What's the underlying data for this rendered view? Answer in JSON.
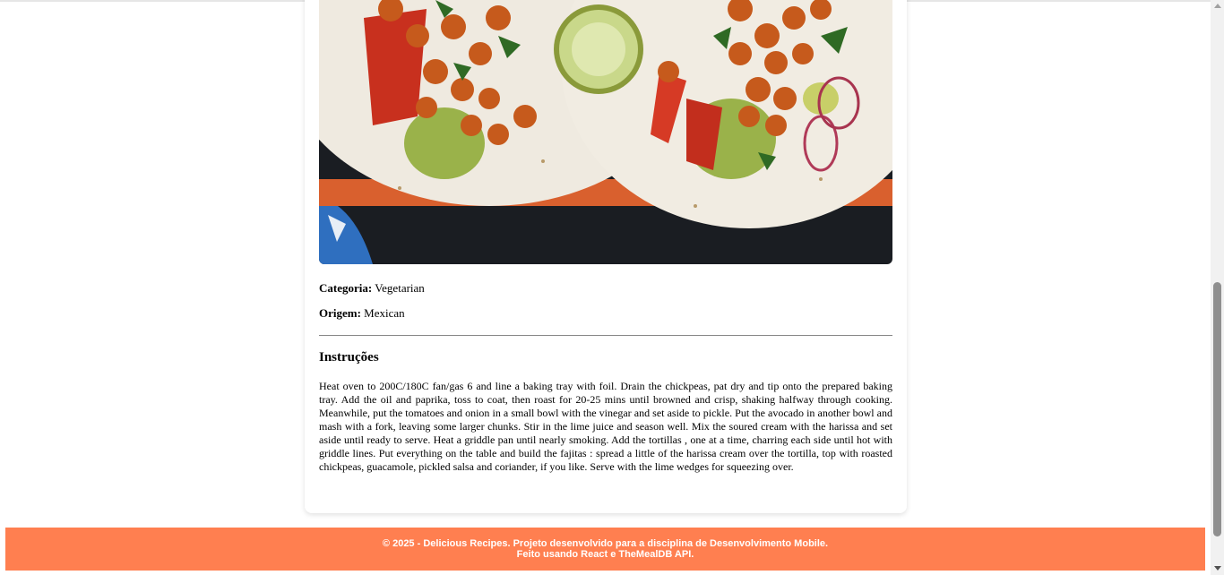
{
  "recipe": {
    "category_label": "Categoria:",
    "category": "Vegetarian",
    "origin_label": "Origem:",
    "origin": "Mexican",
    "instructions_title": "Instruções",
    "instructions": "Heat oven to 200C/180C fan/gas 6 and line a baking tray with foil. Drain the chickpeas, pat dry and tip onto the prepared baking tray. Add the oil and paprika, toss to coat, then roast for 20-25 mins until browned and crisp, shaking halfway through cooking. Meanwhile, put the tomatoes and onion in a small bowl with the vinegar and set aside to pickle. Put the avocado in another bowl and mash with a fork, leaving some larger chunks. Stir in the lime juice and season well. Mix the soured cream with the harissa and set aside until ready to serve. Heat a griddle pan until nearly smoking. Add the tortillas , one at a time, charring each side until hot with griddle lines. Put everything on the table and build the fajitas : spread a little of the harissa cream over the tortilla, top with roasted chickpeas, guacamole, pickled salsa and coriander, if you like. Serve with the lime wedges for squeezing over."
  },
  "footer": {
    "line1": "© 2025 - Delicious Recipes. Projeto desenvolvido para a disciplina de Desenvolvimento Mobile.",
    "line2": "Feito usando React e TheMealDB API."
  },
  "colors": {
    "footer_bg": "#ff7f50",
    "accent": "#ff7f50"
  }
}
